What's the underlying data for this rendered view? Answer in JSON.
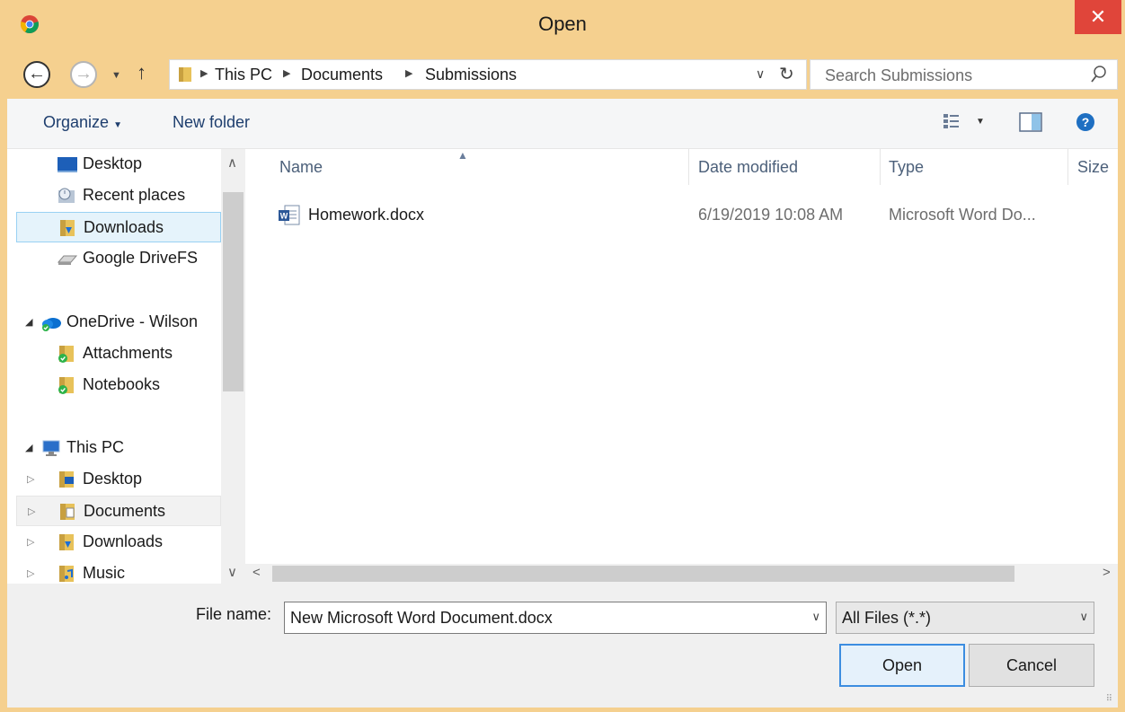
{
  "window": {
    "title": "Open",
    "close_glyph": "✕"
  },
  "address": {
    "crumbs": [
      "This PC",
      "Documents",
      "Submissions"
    ],
    "search_placeholder": "Search Submissions"
  },
  "toolbar": {
    "organize": "Organize",
    "new_folder": "New folder"
  },
  "nav": {
    "items": [
      {
        "label": "Desktop",
        "icon": "desktop-icon"
      },
      {
        "label": "Recent places",
        "icon": "recent-places-icon"
      },
      {
        "label": "Downloads",
        "icon": "downloads-folder-icon",
        "selected": true
      },
      {
        "label": "Google DriveFS",
        "icon": "drive-icon"
      },
      {
        "label": "OneDrive - Wilson",
        "icon": "onedrive-icon",
        "expander": "open"
      },
      {
        "label": "Attachments",
        "icon": "synced-folder-icon"
      },
      {
        "label": "Notebooks",
        "icon": "synced-folder-icon"
      },
      {
        "label": "This PC",
        "icon": "this-pc-icon",
        "expander": "open"
      },
      {
        "label": "Desktop",
        "icon": "desktop-folder-icon",
        "expander": "closed"
      },
      {
        "label": "Documents",
        "icon": "documents-folder-icon",
        "expander": "closed"
      },
      {
        "label": "Downloads",
        "icon": "downloads-folder-icon",
        "expander": "closed"
      },
      {
        "label": "Music",
        "icon": "music-folder-icon",
        "expander": "closed"
      }
    ]
  },
  "columns": {
    "name": "Name",
    "date": "Date modified",
    "type": "Type",
    "size": "Size"
  },
  "files": [
    {
      "name": "Homework.docx",
      "date": "6/19/2019 10:08 AM",
      "type": "Microsoft Word Do...",
      "icon": "word-document-icon"
    }
  ],
  "bottom": {
    "file_name_label": "File name:",
    "file_name_value": "New Microsoft Word Document.docx",
    "filter_value": "All Files (*.*)",
    "open_label": "Open",
    "cancel_label": "Cancel"
  },
  "colors": {
    "accent": "#f5d08f",
    "close": "#e0453a",
    "selection": "#e5f3fb"
  }
}
